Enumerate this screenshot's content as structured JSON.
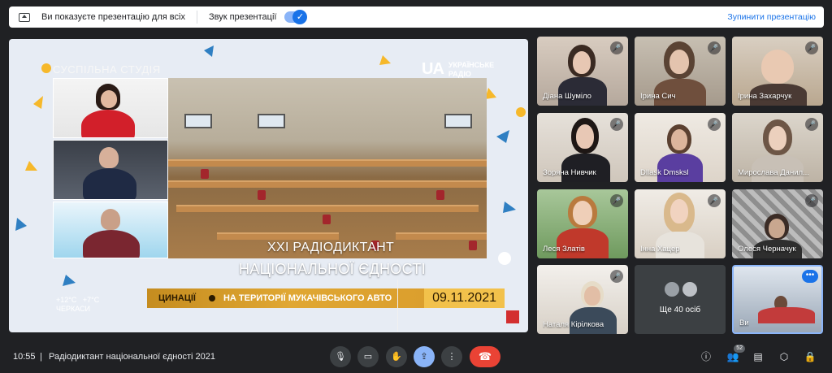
{
  "colors": {
    "background": "#202124",
    "accent": "#1a73e8",
    "hangup": "#ea4335",
    "ticker": "#e0a733"
  },
  "topbar": {
    "message": "Ви показуєте презентацію для всіх",
    "sound_label": "Звук презентації",
    "stop_label": "Зупинити презентацію",
    "toggle_icon": "check-icon"
  },
  "presentation": {
    "studio_logo": "СУСПІЛЬНА СТУДІЯ",
    "ua_logo_mark": "UA",
    "ua_logo_line1": "УКРАЇНСЬКЕ",
    "ua_logo_line2": "РАДІО",
    "title_line1": "XXI РАДІОДИКТАНТ",
    "title_line2": "НАЦІОНАЛЬНОЇ ЄДНОСТІ",
    "ticker_left": "ЦИНАЦІЇ",
    "ticker_right": "НА ТЕРИТОРІЇ МУКАЧІВСЬКОГО АВТО",
    "date": "09.11.2021",
    "weather_temp": "+12°C",
    "weather_city": "ЧЕРКАСИ",
    "weather_temp2": "+7°C"
  },
  "participants": [
    {
      "name": "Діана Шуміло"
    },
    {
      "name": "Ірина Сич"
    },
    {
      "name": "Ірина Захарчук"
    },
    {
      "name": "Зоряна Нивчик"
    },
    {
      "name": "Dllask Dmsksl"
    },
    {
      "name": "Мирослава Данил..."
    },
    {
      "name": "Леся Златів"
    },
    {
      "name": "Інна Хацер"
    },
    {
      "name": "Олеся Черначук"
    },
    {
      "name": "Наталя Кірілкова"
    }
  ],
  "more_tile": {
    "label": "Ще 40 осіб"
  },
  "self_tile": {
    "name": "Ви",
    "menu_icon": "•••"
  },
  "bottombar": {
    "time": "10:55",
    "separator": "|",
    "meeting_title": "Радіодиктант національної єдності 2021",
    "participant_count": "52"
  }
}
